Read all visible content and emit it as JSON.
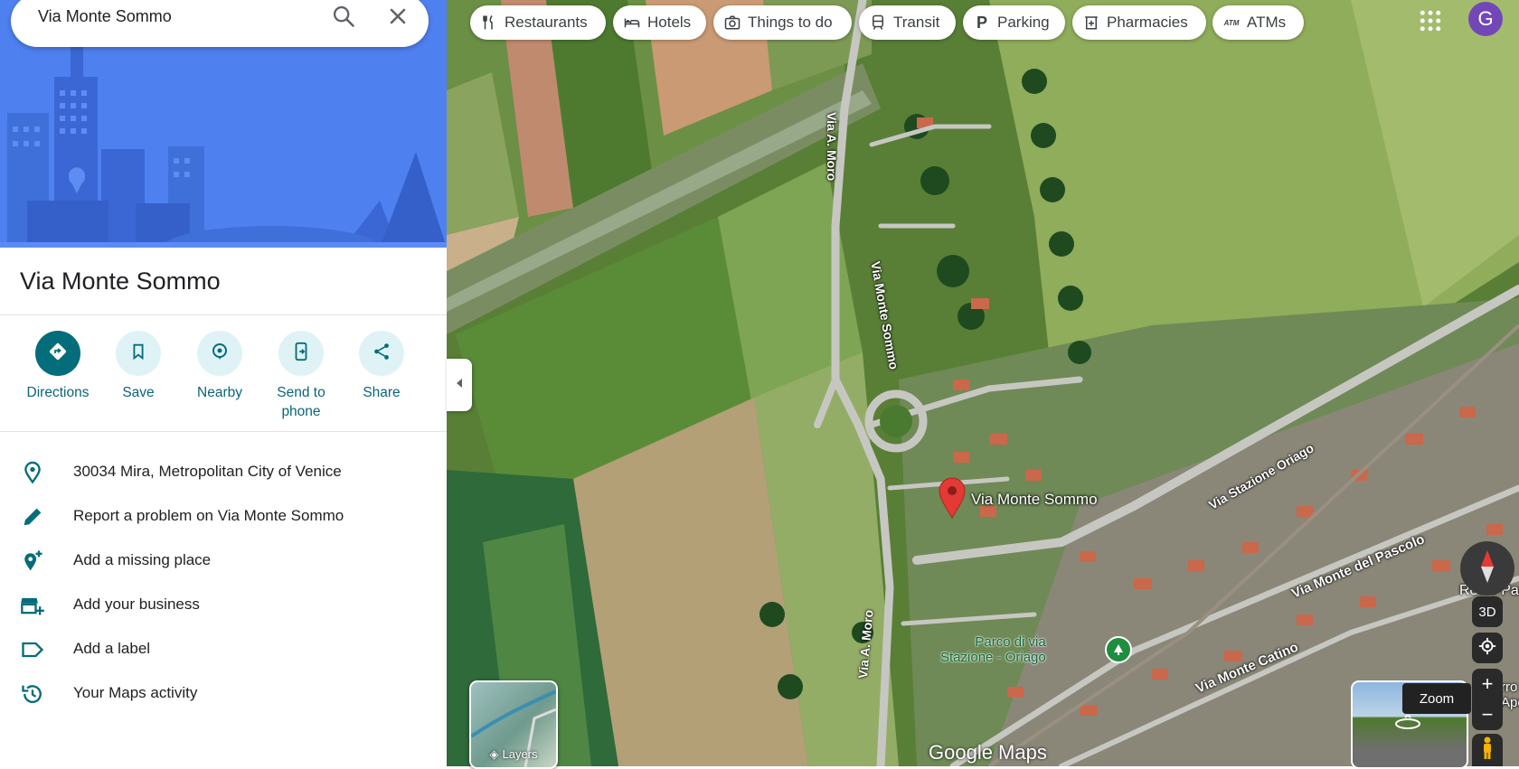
{
  "search": {
    "query": "Via Monte Sommo"
  },
  "place": {
    "title": "Via Monte Sommo"
  },
  "actions": [
    {
      "label": "Directions",
      "icon": "directions-icon"
    },
    {
      "label": "Save",
      "icon": "bookmark-icon"
    },
    {
      "label": "Nearby",
      "icon": "nearby-icon"
    },
    {
      "label": "Send to phone",
      "icon": "send-to-phone-icon"
    },
    {
      "label": "Share",
      "icon": "share-icon"
    }
  ],
  "details": [
    {
      "text": "30034 Mira, Metropolitan City of Venice",
      "icon": "location-pin-icon"
    },
    {
      "text": "Report a problem on Via Monte Sommo",
      "icon": "pencil-icon"
    },
    {
      "text": "Add a missing place",
      "icon": "add-place-icon"
    },
    {
      "text": "Add your business",
      "icon": "add-business-icon"
    },
    {
      "text": "Add a label",
      "icon": "label-icon"
    },
    {
      "text": "Your Maps activity",
      "icon": "history-icon"
    }
  ],
  "chips": [
    {
      "label": "Restaurants",
      "icon": "fork-knife-icon"
    },
    {
      "label": "Hotels",
      "icon": "bed-icon"
    },
    {
      "label": "Things to do",
      "icon": "camera-icon"
    },
    {
      "label": "Transit",
      "icon": "train-icon"
    },
    {
      "label": "Parking",
      "icon": "parking-icon"
    },
    {
      "label": "Pharmacies",
      "icon": "pharmacy-icon"
    },
    {
      "label": "ATMs",
      "icon": "atm-icon"
    }
  ],
  "user": {
    "avatar_letter": "G"
  },
  "map": {
    "pin_label": "Via Monte Sommo",
    "road_labels": {
      "moro_north": "Via A. Moro",
      "monte_sommo": "Via Monte Sommo",
      "moro_south": "Via A. Moro",
      "stazione": "Via Stazione Oriago",
      "pascolo": "Via Monte del Pascolo",
      "catino": "Via Monte Catino"
    },
    "poi": {
      "park": "Parco di via\nStazione - Oriago",
      "pasticceria": "Reale Pasticceria"
    },
    "edge_fragment": "rro\nApo",
    "logo": "Google Maps"
  },
  "controls": {
    "layers_label": "Layers",
    "three_d_label": "3D",
    "zoom_in": "+",
    "zoom_out": "−",
    "zoom_tooltip": "Zoom"
  },
  "colors": {
    "accent": "#046d7b",
    "hero_blue": "#4f7ff0",
    "pin_red": "#e53935",
    "avatar": "#7248b9"
  }
}
